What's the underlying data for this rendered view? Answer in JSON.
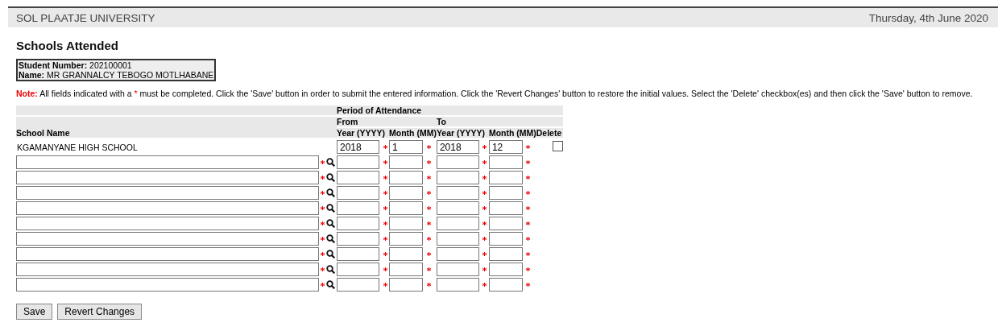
{
  "header": {
    "title": "SOL PLAATJE UNIVERSITY",
    "date": "Thursday, 4th June 2020"
  },
  "page_title": "Schools Attended",
  "student": {
    "number_label": "Student Number:",
    "number": "202100001",
    "name_label": "Name:",
    "name": "MR GRANNALCY TEBOGO MOTLHABANE"
  },
  "note": {
    "label": "Note:",
    "before": "All fields indicated with a",
    "mark": "*",
    "after": "must be completed. Click the 'Save' button in order to submit the entered information. Click the 'Revert Changes' button to restore the initial values. Select the 'Delete' checkbox(es) and then click the 'Save' button to remove."
  },
  "table": {
    "group_heading": "Period of Attendance",
    "from_heading": "From",
    "to_heading": "To",
    "columns": [
      "School Name",
      "Year (YYYY)",
      "Month (MM)",
      "Year (YYYY)",
      "Month (MM)",
      "Delete"
    ],
    "rows": [
      {
        "kind": "saved",
        "school": "KGAMANYANE HIGH SCHOOL",
        "from_year": "2018",
        "from_month": "1",
        "to_year": "2018",
        "to_month": "12",
        "delete": false
      },
      {
        "kind": "new"
      },
      {
        "kind": "new"
      },
      {
        "kind": "new"
      },
      {
        "kind": "new"
      },
      {
        "kind": "new"
      },
      {
        "kind": "new"
      },
      {
        "kind": "new"
      },
      {
        "kind": "new"
      },
      {
        "kind": "new"
      }
    ]
  },
  "buttons": [
    "Save",
    "Revert Changes"
  ]
}
